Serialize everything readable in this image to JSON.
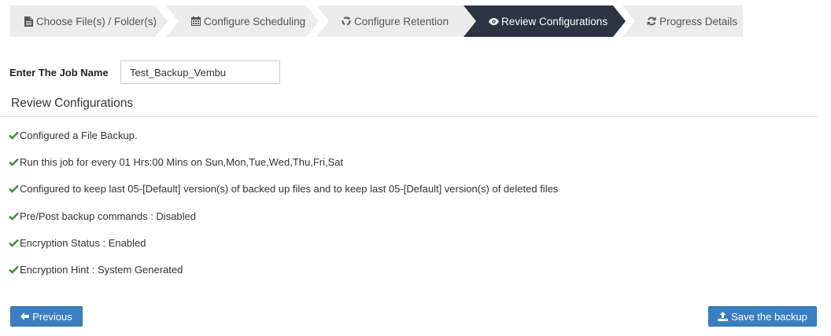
{
  "wizard": {
    "steps": [
      {
        "label": "Choose File(s) / Folder(s)",
        "icon": "file-icon"
      },
      {
        "label": "Configure Scheduling",
        "icon": "calendar-icon"
      },
      {
        "label": "Configure Retention",
        "icon": "recycle-icon"
      },
      {
        "label": "Review Configurations",
        "icon": "eye-icon",
        "active": true
      },
      {
        "label": "Progress Details",
        "icon": "refresh-icon"
      }
    ],
    "active_color": "#2b3541",
    "inactive_color": "#ececec"
  },
  "job": {
    "label": "Enter The Job Name",
    "value": "Test_Backup_Vembu"
  },
  "review": {
    "title": "Review Configurations",
    "items": [
      "Configured a File Backup.",
      "Run this job for every 01 Hrs:00 Mins on Sun,Mon,Tue,Wed,Thu,Fri,Sat",
      "Configured to keep last 05-[Default] version(s) of backed up files and to keep last 05-[Default] version(s) of deleted files",
      "Pre/Post backup commands : Disabled",
      "Encryption Status : Enabled",
      "Encryption Hint : System Generated"
    ],
    "check_color": "#3c8a3c"
  },
  "actions": {
    "previous_label": "Previous",
    "save_label": "Save the backup",
    "button_color": "#3a7fc1"
  }
}
